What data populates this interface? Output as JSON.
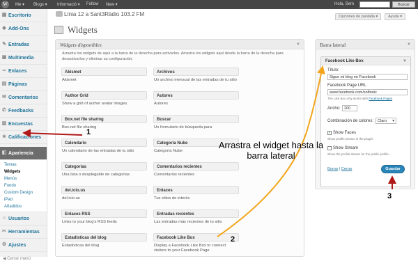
{
  "adminbar": {
    "logo": "W",
    "me": "Me ▾",
    "blogs": "Blogs ▾",
    "info": "Informació ▾",
    "follow": "Follow",
    "new": "New ▾",
    "howdy": "Hola, Sem",
    "search_btn": "Buscar"
  },
  "header": {
    "site_title": "Línia 12 a Sant3Ràdio 103.2 FM",
    "screen_options": "Opciones de pantalla ▾",
    "help": "Ayuda ▾"
  },
  "sidebar": {
    "items": [
      {
        "label": "Escritorio",
        "icon": "dashboard-icon"
      },
      {
        "label": "Add-Ons",
        "icon": "plugin-icon"
      },
      {
        "label": "Entradas",
        "icon": "pin-icon"
      },
      {
        "label": "Multimedia",
        "icon": "media-icon"
      },
      {
        "label": "Enlaces",
        "icon": "link-icon"
      },
      {
        "label": "Páginas",
        "icon": "page-icon"
      },
      {
        "label": "Comentarios",
        "icon": "comment-icon"
      },
      {
        "label": "Feedbacks",
        "icon": "feedback-icon"
      },
      {
        "label": "Encuestas",
        "icon": "poll-icon"
      },
      {
        "label": "Calificaciones",
        "icon": "rating-icon"
      },
      {
        "label": "Apariencia",
        "icon": "appearance-icon"
      },
      {
        "label": "Usuarios",
        "icon": "users-icon"
      },
      {
        "label": "Herramientas",
        "icon": "tools-icon"
      },
      {
        "label": "Ajustes",
        "icon": "settings-icon"
      }
    ],
    "subitems": [
      "Temas",
      "Widgets",
      "Menús",
      "Fondo",
      "Custom Design",
      "iPad",
      "Añadidos"
    ],
    "collapse": "Cerrar menú"
  },
  "page": {
    "title": "Widgets"
  },
  "available": {
    "title": "Widgets disponibles",
    "desc": "Arrastra los widgets de aquí a la barra de la derecha para activarlos. Arrastra los widgets aquí desde la barra de la derecha para desactivarlos y eliminar su configuración.",
    "widgets": [
      {
        "name": "Akismet",
        "desc": "Akismet"
      },
      {
        "name": "Archivos",
        "desc": "Un archivo mensual de las entradas de tu sitio"
      },
      {
        "name": "Author Grid",
        "desc": "Show a grid of author avatar images."
      },
      {
        "name": "Autores",
        "desc": "Autores"
      },
      {
        "name": "Box.net file sharing",
        "desc": "Box.net file sharing"
      },
      {
        "name": "Buscar",
        "desc": "Un formulario de búsqueda para"
      },
      {
        "name": "Calendario",
        "desc": "Un calendario de las entradas de tu sitio"
      },
      {
        "name": "Categoría Nube",
        "desc": "Categoría Nube"
      },
      {
        "name": "Categorías",
        "desc": "Una lista o desplegable de categorías"
      },
      {
        "name": "Comentarios recientes",
        "desc": "Comentarios recientes"
      },
      {
        "name": "del.icio.us",
        "desc": "del.icio.us"
      },
      {
        "name": "Enlaces",
        "desc": "Tus sitios de interés"
      },
      {
        "name": "Enlaces RSS",
        "desc": "Links to your blog's RSS feeds"
      },
      {
        "name": "Entradas recientes",
        "desc": "Las entradas más recientes de tu sitio"
      },
      {
        "name": "Estadísticas del blog",
        "desc": "Estadísticas del blog"
      },
      {
        "name": "Facebook Like Box",
        "desc": "Display a Facebook Like Box to connect visitors to your Facebook Page"
      }
    ]
  },
  "sidebar_area": {
    "title": "Barra lateral",
    "widget": {
      "name": "Facebook Like Box",
      "title_label": "Título:",
      "title_value": "Sigue mi blog en Facebook",
      "url_label": "Facebook Page URL",
      "url_value": "www.facebook.com/softonic",
      "url_hint_text": "The Like Box only works with",
      "url_hint_link": "Facebook Pages",
      "width_label": "Ancho:",
      "width_value": "200",
      "color_label": "Combinación de colores:",
      "color_value": "Claro",
      "faces_label": "Show Faces",
      "faces_hint": "Show profile photos in the plugin.",
      "stream_label": "Show Stream",
      "stream_hint": "Show the profile stream for the public profile.",
      "delete": "Borrar",
      "close": "Cerrar",
      "save": "Guardar"
    }
  },
  "annotations": {
    "n1": "1",
    "n2": "2",
    "n3": "3",
    "instruction": "Arrastra el widget hasta la barra lateral",
    "colors": {
      "arrow_red": "#b01818",
      "arrow_orange": "#f3a51c"
    }
  }
}
